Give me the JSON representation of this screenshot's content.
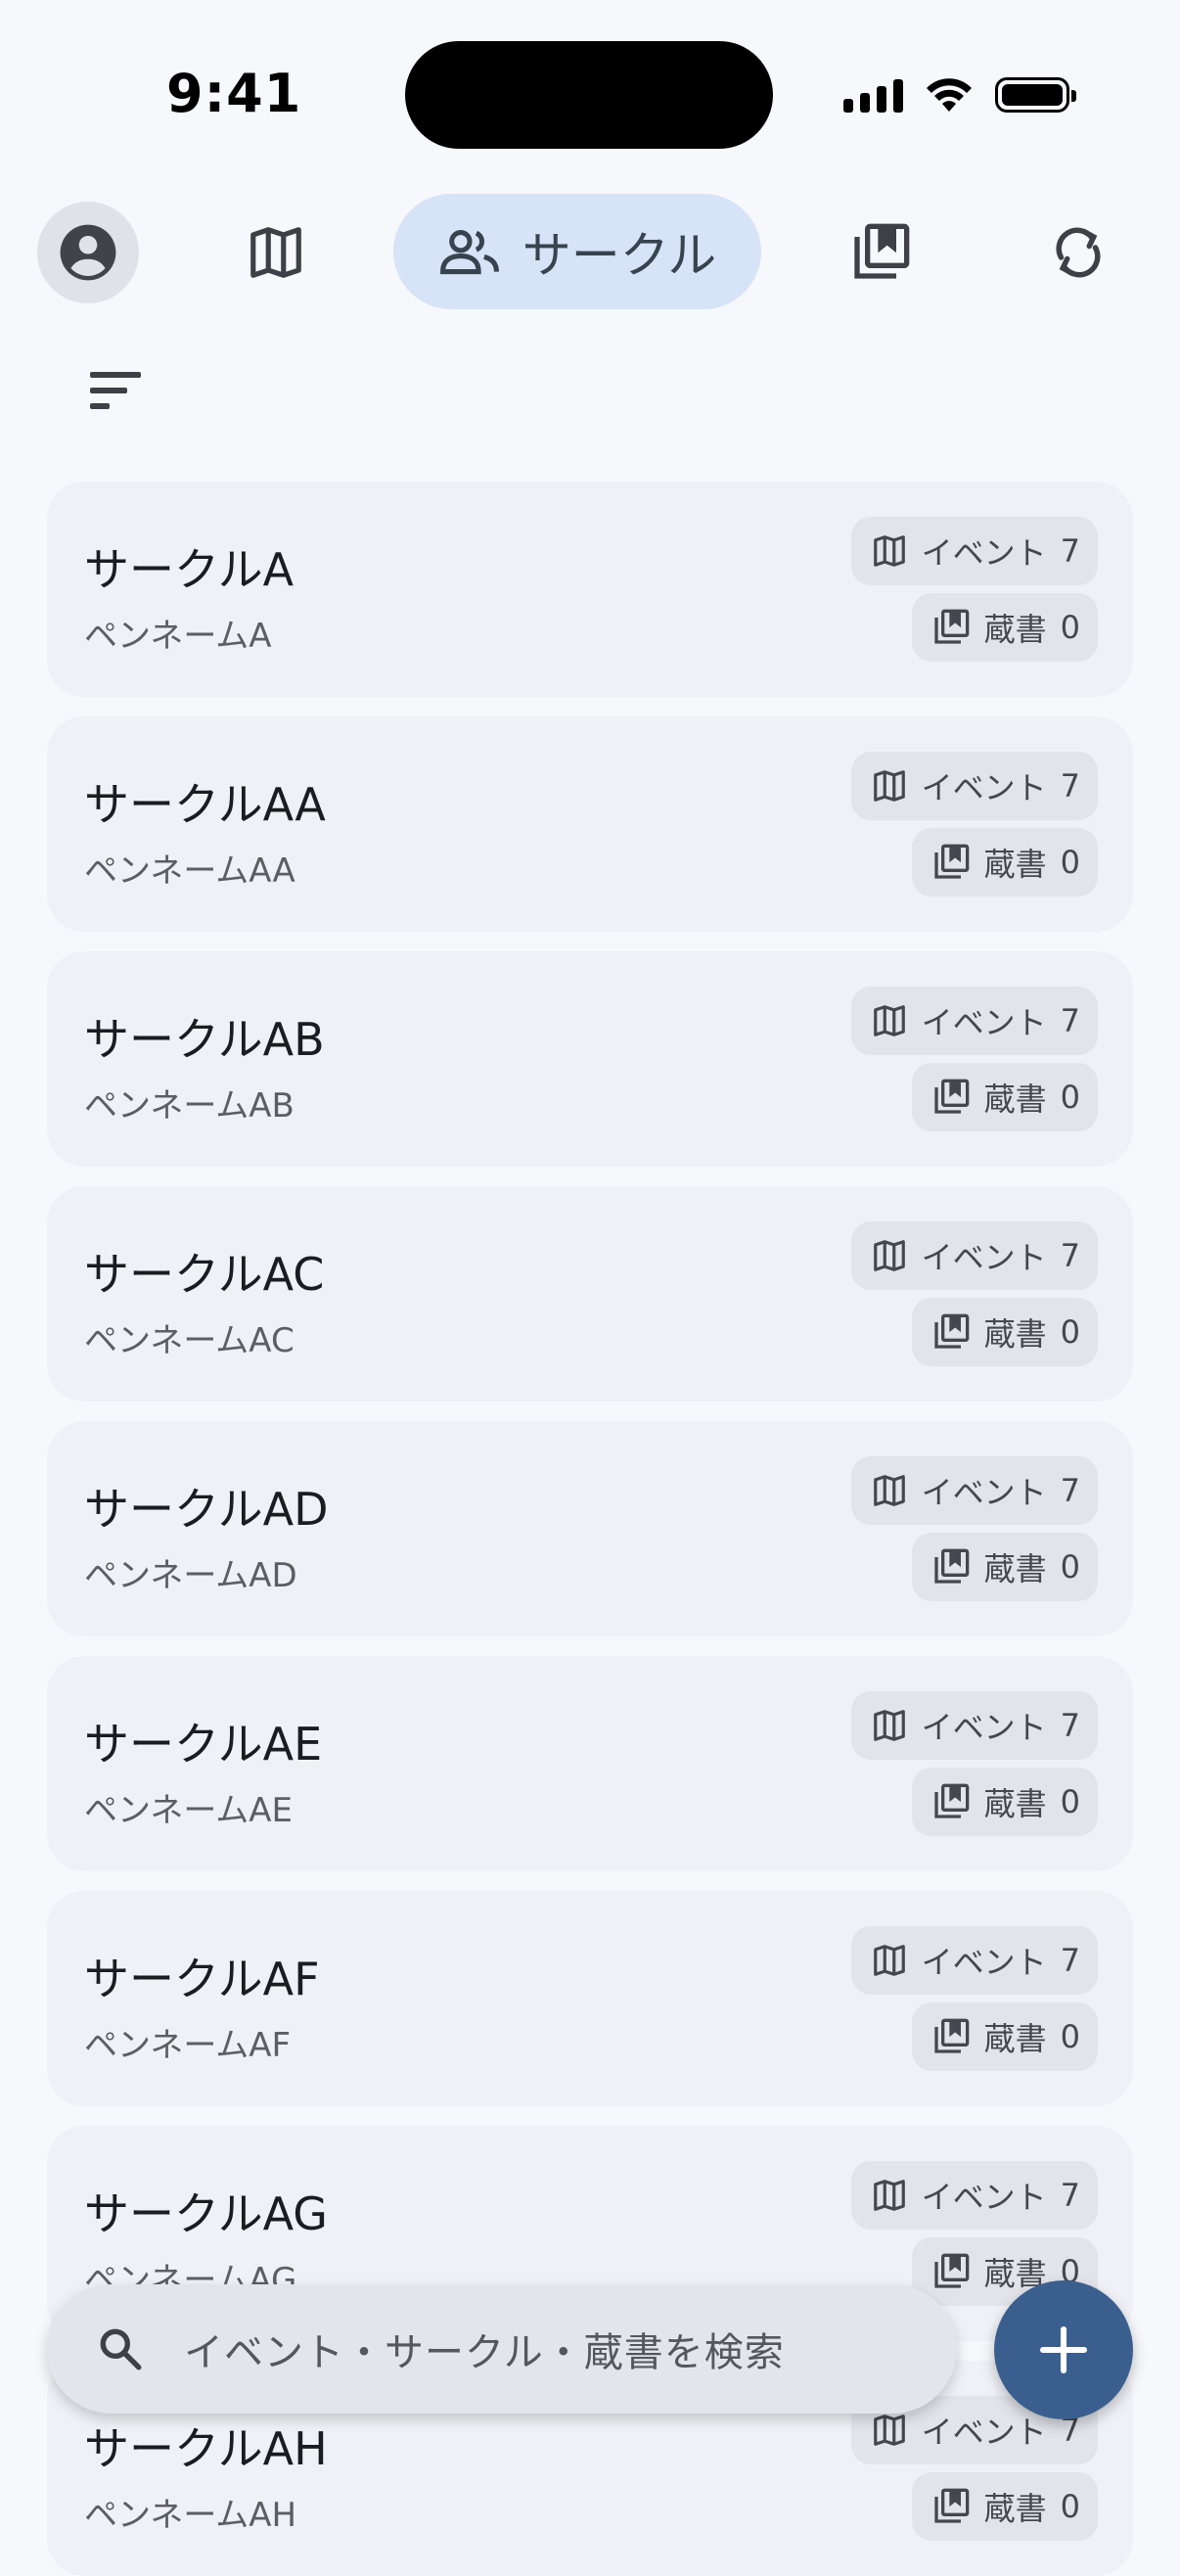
{
  "status": {
    "time": "9:41"
  },
  "nav": {
    "items": [
      {
        "icon": "account-circle-icon"
      },
      {
        "icon": "map-icon"
      },
      {
        "icon": "group-icon",
        "label": "サークル"
      },
      {
        "icon": "library-books-icon"
      },
      {
        "icon": "sync-icon"
      }
    ],
    "active": "サークル",
    "active_color": "#d7e3f6"
  },
  "sort": {
    "icon": "sort-icon"
  },
  "circles": [
    {
      "name": "サークルA",
      "pen_name": "ペンネームA",
      "events_label": "イベント",
      "events": "7",
      "books_label": "蔵書",
      "books": "0"
    },
    {
      "name": "サークルAA",
      "pen_name": "ペンネームAA",
      "events_label": "イベント",
      "events": "7",
      "books_label": "蔵書",
      "books": "0"
    },
    {
      "name": "サークルAB",
      "pen_name": "ペンネームAB",
      "events_label": "イベント",
      "events": "7",
      "books_label": "蔵書",
      "books": "0"
    },
    {
      "name": "サークルAC",
      "pen_name": "ペンネームAC",
      "events_label": "イベント",
      "events": "7",
      "books_label": "蔵書",
      "books": "0"
    },
    {
      "name": "サークルAD",
      "pen_name": "ペンネームAD",
      "events_label": "イベント",
      "events": "7",
      "books_label": "蔵書",
      "books": "0"
    },
    {
      "name": "サークルAE",
      "pen_name": "ペンネームAE",
      "events_label": "イベント",
      "events": "7",
      "books_label": "蔵書",
      "books": "0"
    },
    {
      "name": "サークルAF",
      "pen_name": "ペンネームAF",
      "events_label": "イベント",
      "events": "7",
      "books_label": "蔵書",
      "books": "0"
    },
    {
      "name": "サークルAG",
      "pen_name": "ペンネームAG",
      "events_label": "イベント",
      "events": "7",
      "books_label": "蔵書",
      "books": "0"
    },
    {
      "name": "サークルAH",
      "pen_name": "ペンネームAH",
      "events_label": "イベント",
      "events": "7",
      "books_label": "蔵書",
      "books": "0"
    }
  ],
  "search": {
    "placeholder": "イベント・サークル・蔵書を検索"
  },
  "fab": {
    "icon": "add-icon",
    "color": "#3a5f8f"
  }
}
